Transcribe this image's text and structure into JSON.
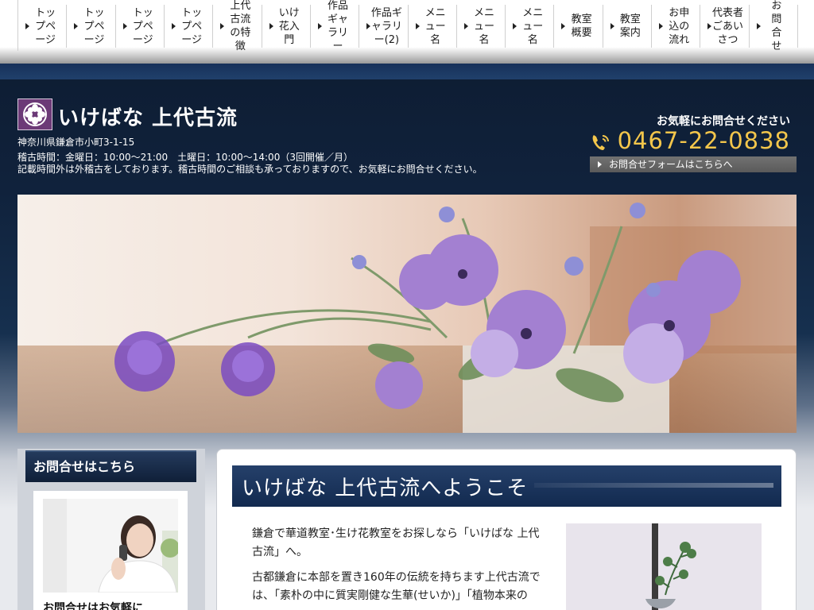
{
  "nav": {
    "items": [
      {
        "label": "トップページ"
      },
      {
        "label": "トップページ"
      },
      {
        "label": "トップページ"
      },
      {
        "label": "トップページ"
      },
      {
        "label": "上代古流の特徴"
      },
      {
        "label": "いけ花入門"
      },
      {
        "label": "作品ギャラリー"
      },
      {
        "label": "作品ギャラリー(2)"
      },
      {
        "label": "メニュー名"
      },
      {
        "label": "メニュー名"
      },
      {
        "label": "メニュー名"
      },
      {
        "label": "教室概要"
      },
      {
        "label": "教室案内"
      },
      {
        "label": "お申込の流れ"
      },
      {
        "label": "代表者ごあいさつ"
      },
      {
        "label": "お問合せ"
      }
    ]
  },
  "header": {
    "site_title": "いけばな 上代古流",
    "address": "神奈川県鎌倉市小町3-1-15",
    "hours": "稽古時間：金曜日：10:00〜21:00　土曜日：10:00〜14:00（3回開催／月）",
    "note": "記載時間外は外稽古をしております。稽古時間のご相談も承っておりますので、お気軽にお問合せください。",
    "contact_prompt": "お気軽にお問合せください",
    "phone": "0467-22-0838",
    "contact_form_label": "お問合せフォームはこちらへ"
  },
  "sidebar": {
    "heading": "お問合せはこちら",
    "card_title": "お問合せはお気軽に"
  },
  "main": {
    "title": "いけばな 上代古流へようこそ",
    "paragraphs": [
      "鎌倉で華道教室･生け花教室をお探しなら「いけばな 上代古流」へ。",
      "古都鎌倉に本部を置き160年の伝統を持ちます上代古流では、「素朴の中に質実剛健な生華(せいか)」「植物本来の"
    ]
  },
  "colors": {
    "header_dark": "#0e1d33",
    "phone_accent": "#f3c64b",
    "logo_purple": "#6c3a77",
    "title_bar": "#1c355c"
  }
}
